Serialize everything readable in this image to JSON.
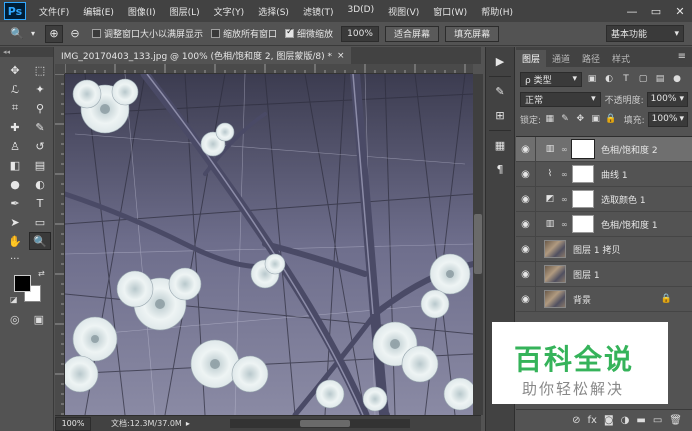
{
  "app": {
    "logo_text": "Ps",
    "menu": [
      "文件(F)",
      "编辑(E)",
      "图像(I)",
      "图层(L)",
      "文字(Y)",
      "选择(S)",
      "滤镜(T)",
      "3D(D)",
      "视图(V)",
      "窗口(W)",
      "帮助(H)"
    ],
    "window_controls": {
      "minimize": "—",
      "restore": "▭",
      "close": "✕"
    }
  },
  "options_bar": {
    "resize_windows_label": "调整窗口大小以满屏显示",
    "resize_windows_checked": false,
    "zoom_all_label": "缩放所有窗口",
    "zoom_all_checked": false,
    "scrubby_zoom_label": "细微缩放",
    "scrubby_zoom_checked": true,
    "zoom_value": "100%",
    "fit_screen_label": "适合屏幕",
    "fill_screen_label": "填充屏幕",
    "workspace": "基本功能"
  },
  "document": {
    "tab_title": "IMG_20170403_133.jpg @ 100% (色相/饱和度 2, 图层蒙版/8) *",
    "tab_close": "×",
    "zoom_status": "100%",
    "doc_info": "文档:12.3M/37.0M"
  },
  "tools": {
    "header": "◂◂",
    "items": [
      {
        "name": "move-tool",
        "glyph": "✥"
      },
      {
        "name": "marquee-tool",
        "glyph": "⬚"
      },
      {
        "name": "lasso-tool",
        "glyph": "ℒ"
      },
      {
        "name": "magic-wand-tool",
        "glyph": "✦"
      },
      {
        "name": "crop-tool",
        "glyph": "⌗"
      },
      {
        "name": "eyedropper-tool",
        "glyph": "⚲"
      },
      {
        "name": "healing-brush-tool",
        "glyph": "✚"
      },
      {
        "name": "brush-tool",
        "glyph": "✎"
      },
      {
        "name": "clone-stamp-tool",
        "glyph": "♙"
      },
      {
        "name": "history-brush-tool",
        "glyph": "↺"
      },
      {
        "name": "eraser-tool",
        "glyph": "◧"
      },
      {
        "name": "gradient-tool",
        "glyph": "▤"
      },
      {
        "name": "blur-tool",
        "glyph": "●"
      },
      {
        "name": "dodge-tool",
        "glyph": "◐"
      },
      {
        "name": "pen-tool",
        "glyph": "✒"
      },
      {
        "name": "type-tool",
        "glyph": "T"
      },
      {
        "name": "path-selection-tool",
        "glyph": "➤"
      },
      {
        "name": "rectangle-tool",
        "glyph": "▭"
      },
      {
        "name": "hand-tool",
        "glyph": "✋"
      },
      {
        "name": "zoom-tool",
        "glyph": "🔍"
      }
    ],
    "more": "···",
    "swap": "⇄",
    "default": "◪",
    "quick_mask": "◎",
    "screen_mode": "▣"
  },
  "dock": [
    "▶",
    "✎",
    "⊞",
    "▦",
    "¶"
  ],
  "layers_panel": {
    "tabs": [
      "图层",
      "通道",
      "路径",
      "样式"
    ],
    "active_tab": 0,
    "menu_icon": "≡",
    "filter_kind": "ρ 类型",
    "blend_mode": "正常",
    "opacity_label": "不透明度:",
    "opacity_value": "100%",
    "lock_label": "锁定:",
    "fill_label": "填充:",
    "fill_value": "100%",
    "layers": [
      {
        "name": "色相/饱和度 2",
        "type": "adjustment",
        "icon": "▥",
        "selected": true
      },
      {
        "name": "曲线 1",
        "type": "adjustment",
        "icon": "⌇",
        "selected": false
      },
      {
        "name": "选取颜色 1",
        "type": "adjustment",
        "icon": "◩",
        "selected": false
      },
      {
        "name": "色相/饱和度 1",
        "type": "adjustment",
        "icon": "▥",
        "selected": false
      },
      {
        "name": "图层 1 拷贝",
        "type": "image",
        "selected": false
      },
      {
        "name": "图层 1",
        "type": "image",
        "selected": false
      },
      {
        "name": "背景",
        "type": "image",
        "selected": false,
        "locked": true
      }
    ],
    "bottom_icons": [
      "⊘",
      "fx",
      "◙",
      "◑",
      "▬",
      "▭",
      "🗑"
    ]
  },
  "watermark": {
    "title": "百科全说",
    "subtitle": "助你轻松解决"
  },
  "colors": {
    "accent": "#31a8ff",
    "watermark_green": "#35b35a"
  }
}
